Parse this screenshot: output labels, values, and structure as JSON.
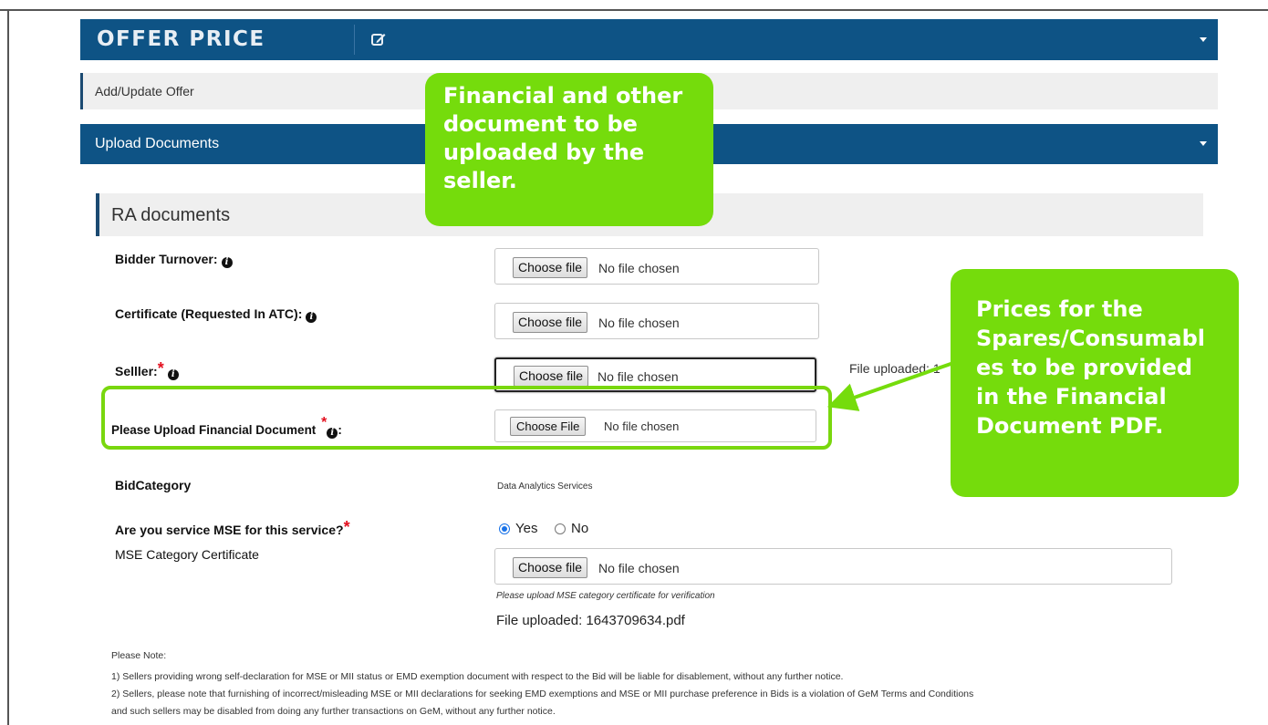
{
  "offer_price": {
    "title": "OFFER PRICE",
    "edit_icon": "edit-icon"
  },
  "add_update": {
    "label": "Add/Update Offer"
  },
  "upload_documents": {
    "label": "Upload Documents"
  },
  "ra_documents": {
    "title": "RA documents"
  },
  "fields": {
    "bidder_turnover": {
      "label": "Bidder Turnover:",
      "button": "Choose file",
      "status": "No file chosen"
    },
    "certificate": {
      "label": "Certificate (Requested In ATC):",
      "button": "Choose file",
      "status": "No file chosen"
    },
    "seller": {
      "label": "Selller:",
      "required_mark": "*",
      "button": "Choose file",
      "status": "No file chosen",
      "uploaded_truncated": "File uploaded: 1"
    },
    "financial": {
      "label": "Please Upload Financial Document",
      "required_mark": "*",
      "suffix": ":",
      "button": "Choose File",
      "status": "No file chosen"
    },
    "bid_category": {
      "label": "BidCategory",
      "value": "Data Analytics Services"
    },
    "mse_service": {
      "label": "Are you service MSE for this service?",
      "required_mark": "*",
      "options": [
        "Yes",
        "No"
      ],
      "selected": "Yes"
    },
    "mse_certificate": {
      "label": "MSE Category Certificate",
      "button": "Choose file",
      "status": "No file chosen",
      "hint": "Please upload MSE category certificate for verification",
      "uploaded": "File uploaded: 1643709634.pdf"
    }
  },
  "notes": {
    "heading": "Please Note:",
    "items": [
      "1) Sellers providing wrong self-declaration for MSE or MII status or EMD exemption document with respect to the Bid will be liable for disablement, without any further notice.",
      "2) Sellers, please note that furnishing of incorrect/misleading MSE or MII declarations for seeking EMD exemptions and MSE or MII purchase preference in Bids is a violation of GeM Terms and Conditions",
      "and such sellers may be disabled from doing any further transactions on GeM, without any further notice."
    ]
  },
  "callouts": {
    "documents": {
      "lines": [
        "Financial and other",
        "document to be",
        "uploaded by the",
        "seller."
      ]
    },
    "prices": {
      "lines": [
        "Prices for the",
        "Spares/Consumabl",
        "es to be provided",
        "in the Financial",
        "Document PDF."
      ]
    }
  },
  "colors": {
    "header_bar": "#0e5385",
    "callout": "#75dc0c",
    "required": "#e3101f"
  }
}
